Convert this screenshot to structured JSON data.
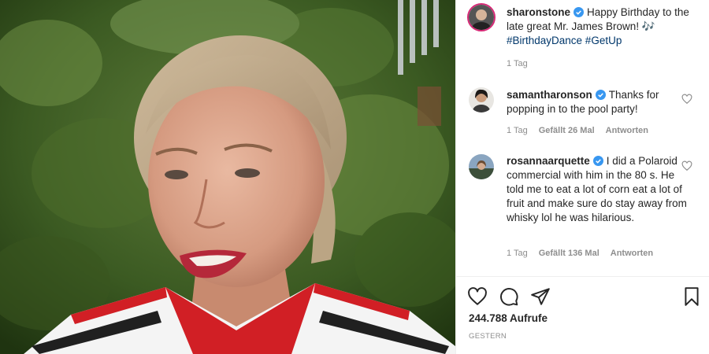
{
  "post": {
    "author": "sharonstone",
    "caption_text": "Happy Birthday to the late great Mr. James Brown! 🎶",
    "hashtags": "#BirthdayDance #GetUp",
    "caption_age": "1 Tag"
  },
  "comments": [
    {
      "username": "samantharonson",
      "text": "Thanks for popping in to the pool party!",
      "age": "1 Tag",
      "likes": "Gefällt 26 Mal",
      "reply": "Antworten"
    },
    {
      "username": "rosannaarquette",
      "text": "I did a Polaroid commercial with him in the 80 s. He told me to eat a lot of corn eat a lot of fruit and make sure do stay away from whisky lol he was hilarious.",
      "age": "1 Tag",
      "likes": "Gefällt 136 Mal",
      "reply": "Antworten"
    }
  ],
  "stats": {
    "views": "244.788 Aufrufe",
    "date": "GESTERN"
  },
  "icons": {
    "verified": "verified-badge-icon",
    "like": "heart-icon",
    "comment": "comment-bubble-icon",
    "share": "paper-plane-icon",
    "save": "bookmark-icon"
  },
  "colors": {
    "verified": "#3897f0",
    "hashtag": "#00376b",
    "muted": "#8e8e8e",
    "text": "#262626"
  }
}
